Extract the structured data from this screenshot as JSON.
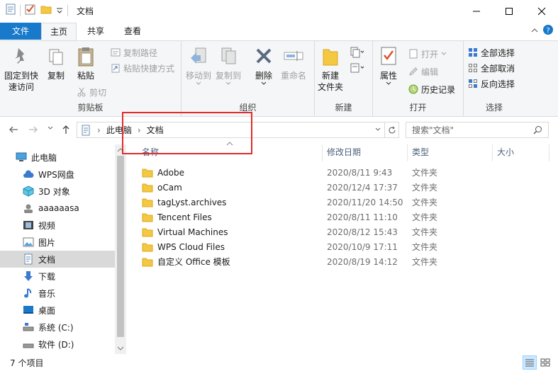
{
  "window": {
    "title": "文档",
    "controls": {
      "minimize": "minimize-icon",
      "maximize": "maximize-icon",
      "close": "close-icon"
    }
  },
  "ribbon_tabs": [
    {
      "label": "文件"
    },
    {
      "label": "主页"
    },
    {
      "label": "共享"
    },
    {
      "label": "查看"
    }
  ],
  "ribbon": {
    "clipboard": {
      "label": "剪贴板",
      "pin": "固定到快\n速访问",
      "pin_1": "固定到快",
      "pin_2": "速访问",
      "copy": "复制",
      "paste": "粘贴",
      "copy_path": "复制路径",
      "paste_shortcut": "粘贴快捷方式",
      "cut": "剪切"
    },
    "organize": {
      "label": "组织",
      "move_to": "移动到",
      "copy_to": "复制到",
      "delete": "删除",
      "rename": "重命名"
    },
    "new": {
      "label": "新建",
      "new_folder_1": "新建",
      "new_folder_2": "文件夹"
    },
    "open": {
      "label": "打开",
      "properties": "属性",
      "open": "打开",
      "edit": "编辑",
      "history": "历史记录"
    },
    "select": {
      "label": "选择",
      "select_all": "全部选择",
      "select_none": "全部取消",
      "invert": "反向选择"
    }
  },
  "address": {
    "crumbs": [
      "此电脑",
      "文档"
    ],
    "search_placeholder": "搜索\"文档\""
  },
  "sidebar": {
    "items": [
      {
        "label": "此电脑",
        "icon": "computer-icon"
      },
      {
        "label": "WPS网盘",
        "icon": "cloud-icon"
      },
      {
        "label": "3D 对象",
        "icon": "cube-icon"
      },
      {
        "label": "aaaaaasa",
        "icon": "user-icon"
      },
      {
        "label": "视频",
        "icon": "video-icon"
      },
      {
        "label": "图片",
        "icon": "picture-icon"
      },
      {
        "label": "文档",
        "icon": "document-icon"
      },
      {
        "label": "下载",
        "icon": "download-icon"
      },
      {
        "label": "音乐",
        "icon": "music-icon"
      },
      {
        "label": "桌面",
        "icon": "desktop-icon"
      },
      {
        "label": "系统 (C:)",
        "icon": "drive-icon"
      },
      {
        "label": "软件 (D:)",
        "icon": "drive-icon"
      }
    ]
  },
  "columns": {
    "name": "名称",
    "modified": "修改日期",
    "type": "类型",
    "size": "大小"
  },
  "files": [
    {
      "name": "Adobe",
      "modified": "2020/8/11 9:43",
      "type": "文件夹"
    },
    {
      "name": "oCam",
      "modified": "2020/12/4 17:37",
      "type": "文件夹"
    },
    {
      "name": "tagLyst.archives",
      "modified": "2020/11/20 14:50",
      "type": "文件夹"
    },
    {
      "name": "Tencent Files",
      "modified": "2020/8/11 11:10",
      "type": "文件夹"
    },
    {
      "name": "Virtual Machines",
      "modified": "2020/8/12 15:43",
      "type": "文件夹"
    },
    {
      "name": "WPS Cloud Files",
      "modified": "2020/10/9 17:11",
      "type": "文件夹"
    },
    {
      "name": "自定义 Office 模板",
      "modified": "2020/8/19 14:12",
      "type": "文件夹"
    }
  ],
  "status": {
    "count": "7 个项目"
  },
  "colors": {
    "file_tab": "#1979ca",
    "folder": "#f5c842",
    "highlight": "#e02b2b",
    "selected_nav": "#d9d9d9"
  }
}
